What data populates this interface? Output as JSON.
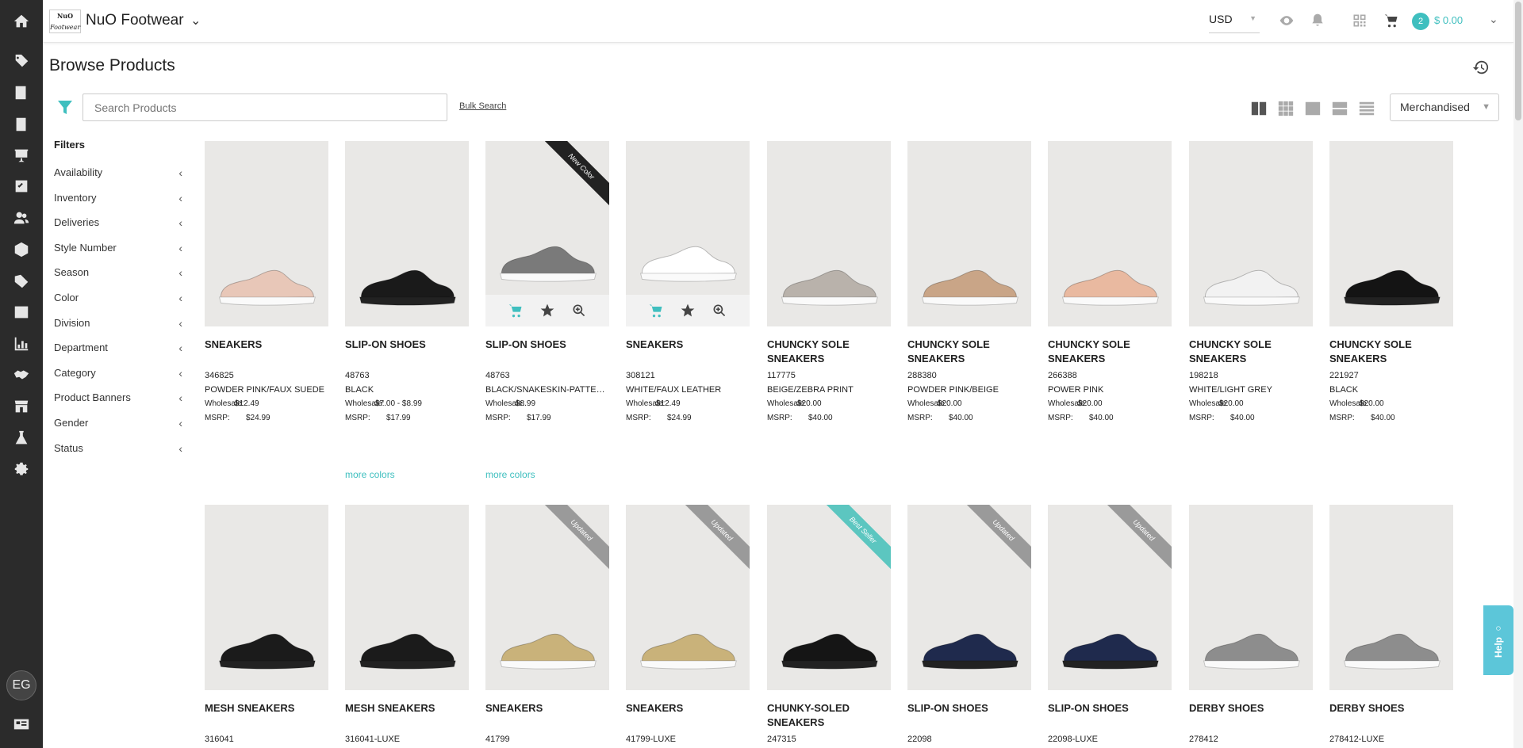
{
  "app": {
    "brand": "NuO Footwear",
    "logo_text": "NuO",
    "logo_sub": "Footwear"
  },
  "topbar": {
    "currency": "USD",
    "cart_count": "2",
    "cart_total": "$ 0.00"
  },
  "page": {
    "title": "Browse Products"
  },
  "search": {
    "placeholder": "Search Products",
    "bulk_label": "Bulk Search"
  },
  "sort": {
    "selected": "Merchandised"
  },
  "filters": {
    "heading": "Filters",
    "items": [
      "Availability",
      "Inventory",
      "Deliveries",
      "Style Number",
      "Season",
      "Color",
      "Division",
      "Department",
      "Category",
      "Product Banners",
      "Gender",
      "Status"
    ]
  },
  "user": {
    "initials": "EG"
  },
  "help": {
    "label": "Help"
  },
  "labels": {
    "wholesale": "Wholesale:",
    "msrp": "MSRP:",
    "more_colors": "more colors"
  },
  "products_row1": [
    {
      "name": "SNEAKERS",
      "sku": "346825",
      "color": "POWDER PINK/FAUX SUEDE",
      "wholesale": "$12.49",
      "msrp": "$24.99",
      "shoe_color": "#e8c7b8"
    },
    {
      "name": "SLIP-ON SHOES",
      "sku": "48763",
      "color": "BLACK",
      "wholesale": "$7.00 - $8.99",
      "msrp": "$17.99",
      "more": true,
      "shoe_color": "#1a1a1a"
    },
    {
      "name": "SLIP-ON SHOES",
      "sku": "48763",
      "color": "BLACK/SNAKESKIN-PATTERNED",
      "wholesale": "$8.99",
      "msrp": "$17.99",
      "ribbon": "New Color",
      "ribbon_color": "#222222",
      "more": true,
      "actions": true,
      "shoe_color": "#7a7a7a"
    },
    {
      "name": "SNEAKERS",
      "sku": "308121",
      "color": "WHITE/FAUX LEATHER",
      "wholesale": "$12.49",
      "msrp": "$24.99",
      "actions": true,
      "shoe_color": "#ffffff"
    },
    {
      "name": "CHUNCKY SOLE SNEAKERS",
      "sku": "117775",
      "color": "BEIGE/ZEBRA PRINT",
      "wholesale": "$20.00",
      "msrp": "$40.00",
      "shoe_color": "#b9b2ab"
    },
    {
      "name": "CHUNCKY SOLE SNEAKERS",
      "sku": "288380",
      "color": "POWDER PINK/BEIGE",
      "wholesale": "$20.00",
      "msrp": "$40.00",
      "shoe_color": "#c9a587"
    },
    {
      "name": "CHUNCKY SOLE SNEAKERS",
      "sku": "266388",
      "color": "POWER PINK",
      "wholesale": "$20.00",
      "msrp": "$40.00",
      "shoe_color": "#e9b9a0"
    },
    {
      "name": "CHUNCKY SOLE SNEAKERS",
      "sku": "198218",
      "color": "WHITE/LIGHT GREY",
      "wholesale": "$20.00",
      "msrp": "$40.00",
      "shoe_color": "#f2f2f2"
    },
    {
      "name": "CHUNCKY SOLE SNEAKERS",
      "sku": "221927",
      "color": "BLACK",
      "wholesale": "$20.00",
      "msrp": "$40.00",
      "shoe_color": "#141414"
    }
  ],
  "products_row2": [
    {
      "name": "MESH SNEAKERS",
      "sku": "316041",
      "shoe_color": "#1b1b1b"
    },
    {
      "name": "MESH SNEAKERS",
      "sku": "316041-LUXE",
      "shoe_color": "#1b1b1b"
    },
    {
      "name": "SNEAKERS",
      "sku": "41799",
      "ribbon": "Updated",
      "ribbon_color": "#9a9a9a",
      "shoe_color": "#c9b27a"
    },
    {
      "name": "SNEAKERS",
      "sku": "41799-LUXE",
      "ribbon": "Updated",
      "ribbon_color": "#9a9a9a",
      "shoe_color": "#c9b27a"
    },
    {
      "name": "CHUNKY-SOLED SNEAKERS",
      "sku": "247315",
      "ribbon": "Best Seller",
      "ribbon_color": "#5cc6c0",
      "shoe_color": "#151515"
    },
    {
      "name": "SLIP-ON SHOES",
      "sku": "22098",
      "ribbon": "Updated",
      "ribbon_color": "#9a9a9a",
      "shoe_color": "#1f2a4d"
    },
    {
      "name": "SLIP-ON SHOES",
      "sku": "22098-LUXE",
      "ribbon": "Updated",
      "ribbon_color": "#9a9a9a",
      "shoe_color": "#1f2a4d"
    },
    {
      "name": "DERBY SHOES",
      "sku": "278412",
      "shoe_color": "#8d8d8d"
    },
    {
      "name": "DERBY SHOES",
      "sku": "278412-LUXE",
      "shoe_color": "#8d8d8d"
    }
  ],
  "colors": {
    "accent": "#3fbfbf",
    "rail": "#2b2b2b"
  }
}
